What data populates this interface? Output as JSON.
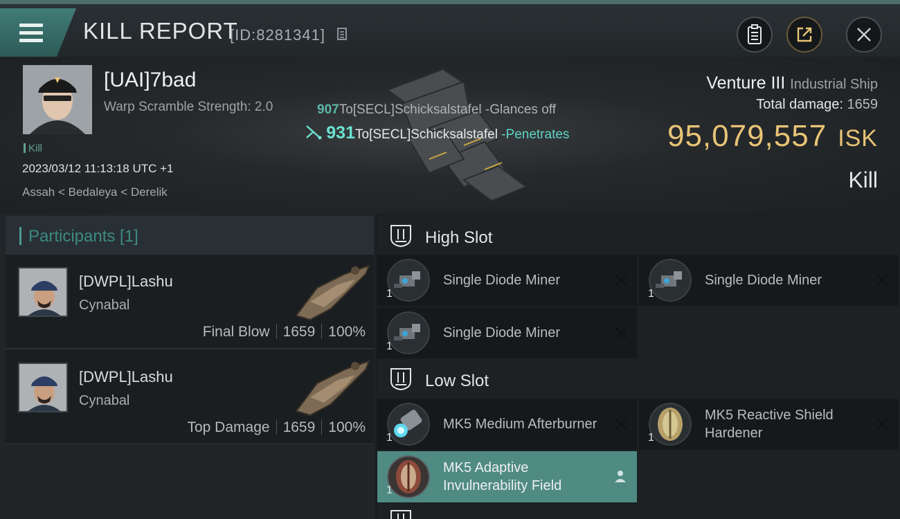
{
  "header": {
    "title": "KILL REPORT",
    "report_id": "[ID:8281341]"
  },
  "victim": {
    "name": "[UAI]7bad",
    "warp_scramble": "Warp Scramble Strength: 2.0",
    "status": "Kill",
    "timestamp": "2023/03/12 11:13:18 UTC +1",
    "location": "Assah < Bedaleya < Derelik",
    "ship_name": "Venture III",
    "ship_class": "Industrial Ship",
    "total_damage_label": "Total damage:",
    "total_damage": "1659",
    "isk_value": "95,079,557",
    "isk_unit": "ISK",
    "kill_type": "Kill"
  },
  "combat_log": [
    {
      "amount": "907",
      "target": "To[SECL]Schicksalstafel",
      "result": "-Glances off"
    },
    {
      "amount": "931",
      "target": "To[SECL]Schicksalstafel",
      "result": "-Penetrates"
    }
  ],
  "participants": {
    "title": "Participants [1]",
    "rows": [
      {
        "name": "[DWPL]Lashu",
        "ship": "Cynabal",
        "role": "Final Blow",
        "damage": "1659",
        "percent": "100%"
      },
      {
        "name": "[DWPL]Lashu",
        "ship": "Cynabal",
        "role": "Top Damage",
        "damage": "1659",
        "percent": "100%"
      }
    ]
  },
  "fitting": {
    "high_slot": {
      "title": "High Slot",
      "modules": [
        {
          "name": "Single Diode Miner",
          "qty": "1"
        },
        {
          "name": "Single Diode Miner",
          "qty": "1"
        },
        {
          "name": "Single Diode Miner",
          "qty": "1"
        }
      ]
    },
    "low_slot": {
      "title": "Low Slot",
      "modules": [
        {
          "name": "MK5 Medium Afterburner",
          "qty": "1"
        },
        {
          "name": "MK5 Reactive Shield Hardener",
          "qty": "1"
        },
        {
          "name": "MK5 Adaptive Invulnerability Field",
          "qty": "1"
        }
      ]
    }
  },
  "colors": {
    "accent": "#4f8a83",
    "isk": "#e8c476",
    "penetrate": "#5fd3c4"
  }
}
